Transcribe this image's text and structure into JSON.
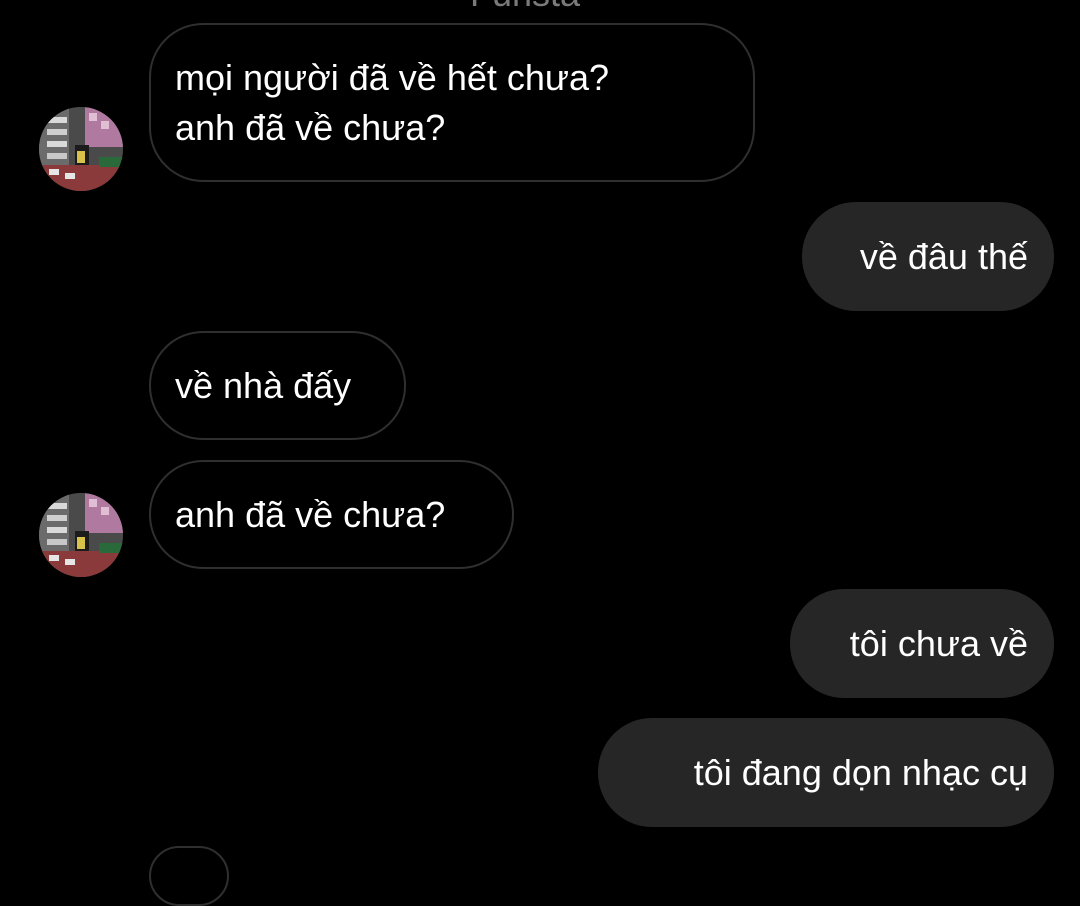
{
  "header": {
    "contact_name_partial": "Funsta"
  },
  "conversation": {
    "messages": [
      {
        "direction": "incoming",
        "lines": [
          "mọi người đã về hết chưa?",
          "anh đã về chưa?"
        ],
        "avatar": "contact-avatar"
      },
      {
        "direction": "outgoing",
        "text": "về đâu thế"
      },
      {
        "direction": "incoming",
        "text": "về nhà đấy"
      },
      {
        "direction": "incoming",
        "text": "anh đã về chưa?",
        "avatar": "contact-avatar"
      },
      {
        "direction": "outgoing",
        "text": "tôi chưa về"
      },
      {
        "direction": "outgoing",
        "text": "tôi đang dọn nhạc cụ"
      }
    ]
  },
  "colors": {
    "background": "#000000",
    "incoming_bubble_border": "#2f2f2f",
    "outgoing_bubble_fill": "#262626",
    "text": "#ffffff"
  }
}
